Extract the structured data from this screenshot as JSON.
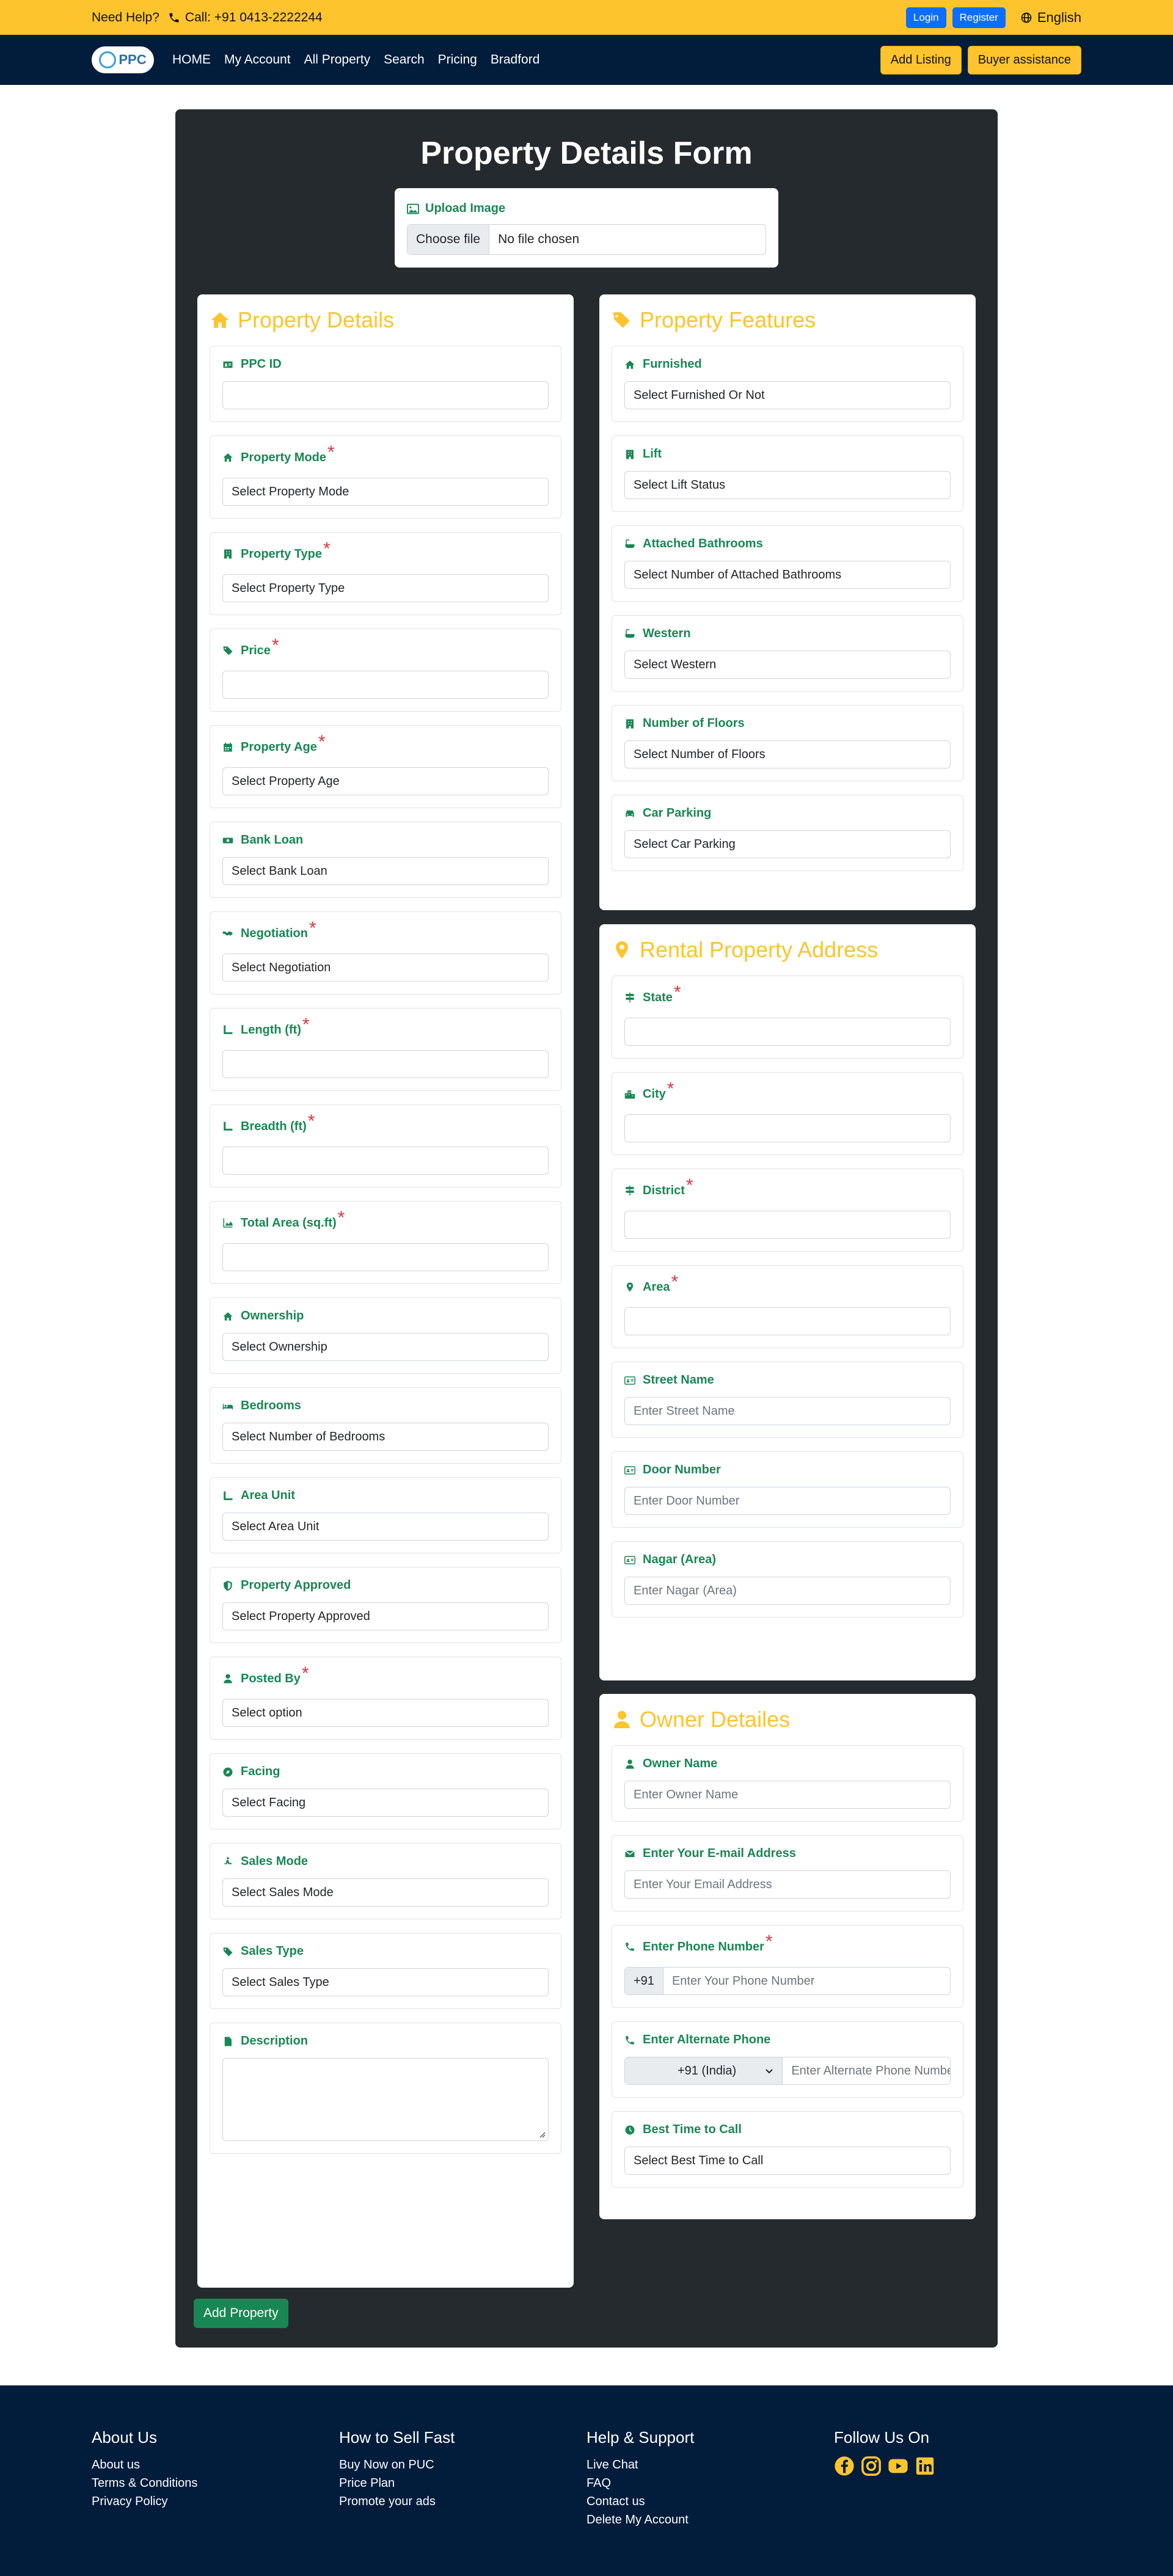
{
  "topbar": {
    "need_help": "Need Help?",
    "call": "Call: +91 0413-2222244",
    "login": "Login",
    "register": "Register",
    "language": "English"
  },
  "nav": {
    "logo_text": "PPC",
    "links": [
      "HOME",
      "My Account",
      "All Property",
      "Search",
      "Pricing",
      "Bradford"
    ],
    "add_listing": "Add Listing",
    "buyer_assistance": "Buyer assistance"
  },
  "form": {
    "title": "Property Details Form",
    "upload": {
      "label": "Upload Image",
      "button": "Choose file",
      "status": "No file chosen"
    },
    "property_details": {
      "title": "Property Details",
      "fields": [
        {
          "label": "PPC ID",
          "value": "",
          "required": false,
          "icon": "id-card-icon"
        },
        {
          "label": "Property Mode",
          "value": "Select Property Mode",
          "required": true,
          "icon": "home-icon"
        },
        {
          "label": "Property Type",
          "value": "Select Property Type",
          "required": true,
          "icon": "building-icon"
        },
        {
          "label": "Price",
          "value": "",
          "required": true,
          "icon": "tag-icon"
        },
        {
          "label": "Property Age",
          "value": "Select Property Age",
          "required": true,
          "icon": "calendar-icon"
        },
        {
          "label": "Bank Loan",
          "value": "Select Bank Loan",
          "required": false,
          "icon": "money-icon"
        },
        {
          "label": "Negotiation",
          "value": "Select Negotiation",
          "required": true,
          "icon": "handshake-icon"
        },
        {
          "label": "Length (ft)",
          "value": "",
          "required": true,
          "icon": "ruler-icon"
        },
        {
          "label": "Breadth (ft)",
          "value": "",
          "required": true,
          "icon": "ruler-icon"
        },
        {
          "label": "Total Area (sq.ft)",
          "value": "",
          "required": true,
          "icon": "chart-area-icon"
        },
        {
          "label": "Ownership",
          "value": "Select Ownership",
          "required": false,
          "icon": "home-icon"
        },
        {
          "label": "Bedrooms",
          "value": "Select Number of Bedrooms",
          "required": false,
          "icon": "bed-icon"
        },
        {
          "label": "Area Unit",
          "value": "Select Area Unit",
          "required": false,
          "icon": "ruler-icon"
        },
        {
          "label": "Property Approved",
          "value": "Select Property Approved",
          "required": false,
          "icon": "shield-icon"
        },
        {
          "label": "Posted By",
          "value": "Select option",
          "required": true,
          "icon": "user-icon"
        },
        {
          "label": "Facing",
          "value": "Select Facing",
          "required": false,
          "icon": "compass-icon"
        },
        {
          "label": "Sales Mode",
          "value": "Select Sales Mode",
          "required": false,
          "icon": "person-icon"
        },
        {
          "label": "Sales Type",
          "value": "Select Sales Type",
          "required": false,
          "icon": "tag-icon"
        }
      ],
      "description_label": "Description"
    },
    "property_features": {
      "title": "Property Features",
      "fields": [
        {
          "label": "Furnished",
          "value": "Select Furnished Or Not",
          "icon": "home-icon"
        },
        {
          "label": "Lift",
          "value": "Select Lift Status",
          "icon": "building-icon"
        },
        {
          "label": "Attached Bathrooms",
          "value": "Select Number of Attached Bathrooms",
          "icon": "bath-icon"
        },
        {
          "label": "Western",
          "value": "Select Western",
          "icon": "bath-icon"
        },
        {
          "label": "Number of Floors",
          "value": "Select Number of Floors",
          "icon": "building-icon"
        },
        {
          "label": "Car Parking",
          "value": "Select Car Parking",
          "icon": "car-icon"
        }
      ]
    },
    "rental_address": {
      "title": "Rental Property Address",
      "fields": [
        {
          "label": "State",
          "value": "",
          "required": true,
          "placeholder": false,
          "icon": "signpost-icon"
        },
        {
          "label": "City",
          "value": "",
          "required": true,
          "placeholder": false,
          "icon": "city-icon"
        },
        {
          "label": "District",
          "value": "",
          "required": true,
          "placeholder": false,
          "icon": "signpost-icon"
        },
        {
          "label": "Area",
          "value": "",
          "required": true,
          "placeholder": false,
          "icon": "map-pin-icon"
        },
        {
          "label": "Street Name",
          "value": "Enter Street Name",
          "required": false,
          "placeholder": true,
          "icon": "address-card-icon"
        },
        {
          "label": "Door Number",
          "value": "Enter Door Number",
          "required": false,
          "placeholder": true,
          "icon": "address-card-icon"
        },
        {
          "label": "Nagar (Area)",
          "value": "Enter Nagar (Area)",
          "required": false,
          "placeholder": true,
          "icon": "address-card-icon"
        }
      ]
    },
    "owner_details": {
      "title": "Owner Detailes",
      "owner_name_label": "Owner Name",
      "owner_name_placeholder": "Enter Owner Name",
      "email_label": "Enter Your E-mail Address",
      "email_placeholder": "Enter Your Email Address",
      "phone_label": "Enter Phone Number",
      "phone_code": "+91",
      "phone_placeholder": "Enter Your Phone Number",
      "alt_phone_label": "Enter Alternate Phone",
      "alt_phone_code": "+91 (India)",
      "alt_phone_placeholder": "Enter Alternate Phone Number",
      "best_time_label": "Best Time to Call",
      "best_time_value": "Select Best Time to Call"
    },
    "submit": "Add Property"
  },
  "footer": {
    "about": {
      "title": "About Us",
      "items": [
        "About us",
        "Terms & Conditions",
        "Privacy Policy"
      ]
    },
    "sell": {
      "title": "How to Sell Fast",
      "items": [
        "Buy Now on PUC",
        "Price Plan",
        "Promote your ads"
      ]
    },
    "help": {
      "title": "Help & Support",
      "items": [
        "Live Chat",
        "FAQ",
        "Contact us",
        "Delete My Account"
      ]
    },
    "follow": {
      "title": "Follow Us On"
    }
  },
  "colors": {
    "accent": "#fec42d",
    "navy": "#021c3c",
    "form_bg": "#252a2e",
    "label_green": "#198754",
    "required_red": "#dc3545",
    "button_blue": "#0d6efd"
  }
}
